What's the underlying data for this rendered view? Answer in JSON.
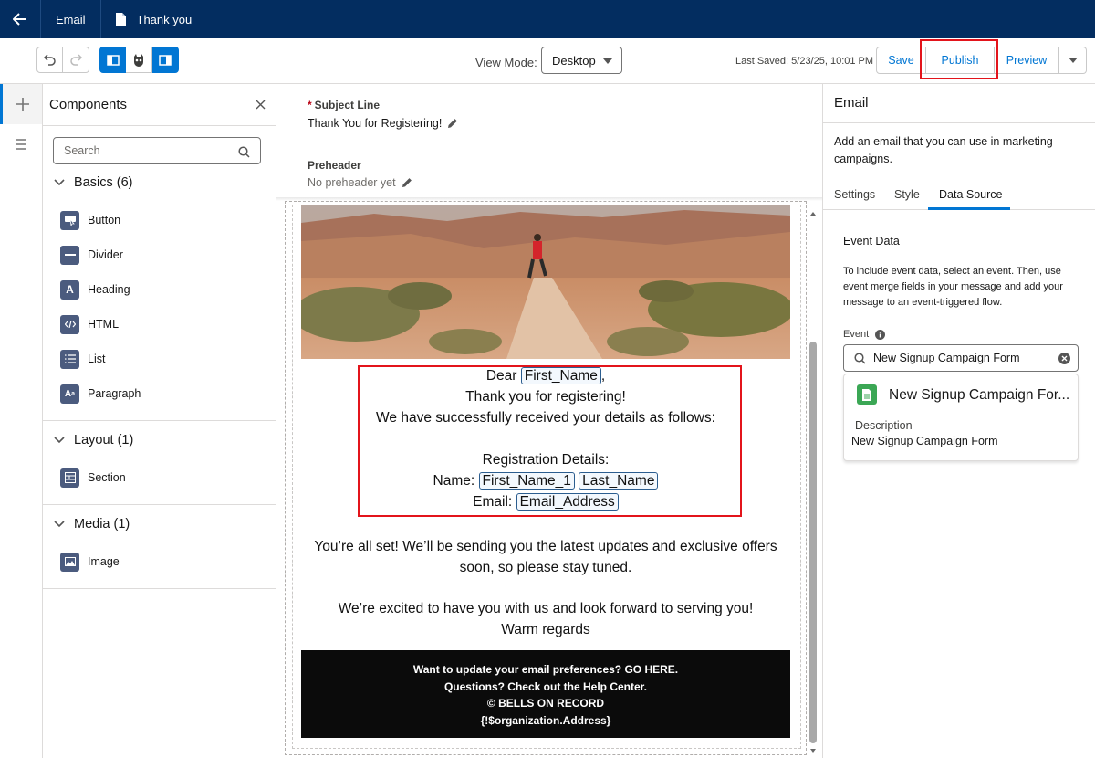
{
  "topbar": {
    "tabs": [
      {
        "label": "Email"
      },
      {
        "label": "Thank you"
      }
    ]
  },
  "toolbar": {
    "view_mode_label": "View Mode:",
    "view_mode_value": "Desktop",
    "last_saved": "Last Saved: 5/23/25, 10:01 PM",
    "save_label": "Save",
    "publish_label": "Publish",
    "preview_label": "Preview"
  },
  "components": {
    "title": "Components",
    "search_placeholder": "Search",
    "sections": [
      {
        "label": "Basics (6)",
        "items": [
          "Button",
          "Divider",
          "Heading",
          "HTML",
          "List",
          "Paragraph"
        ]
      },
      {
        "label": "Layout (1)",
        "items": [
          "Section"
        ]
      },
      {
        "label": "Media (1)",
        "items": [
          "Image"
        ]
      }
    ]
  },
  "canvas": {
    "subject_label": "Subject Line",
    "subject_value": "Thank You for Registering!",
    "preheader_label": "Preheader",
    "preheader_value": "No preheader yet",
    "email": {
      "dear": "Dear",
      "first_name": "First_Name",
      "comma": ",",
      "thanks": "Thank you for registering!",
      "received": "We have successfully received your details as follows:",
      "reg_details": "Registration Details:",
      "name_label": "Name:",
      "first_name_1": "First_Name_1",
      "last_name": "Last_Name",
      "email_label": "Email:",
      "email_address": "Email_Address",
      "all_set_1": "You’re all set! We’ll be sending you the latest updates and exclusive offers",
      "all_set_2": "soon, so please stay tuned.",
      "excited": "We’re excited to have you with us and look forward to serving you!",
      "regards": "Warm regards",
      "footer": [
        "Want to update your email preferences? GO HERE.",
        "Questions? Check out the Help Center.",
        "© BELLS ON RECORD",
        "{!$organization.Address}"
      ]
    }
  },
  "right_panel": {
    "title": "Email",
    "description": "Add an email that you can use in marketing campaigns.",
    "tabs": [
      "Settings",
      "Style",
      "Data Source"
    ],
    "active_tab": "Data Source",
    "event_data_title": "Event Data",
    "event_data_desc": "To include event data, select an event. Then, use event merge fields in your message and add your message to an event-triggered flow.",
    "event_label": "Event",
    "event_value": "New Signup Campaign Form",
    "card_title": "New Signup Campaign For...",
    "card_desc_label": "Description",
    "card_desc_value": "New Signup Campaign Form"
  },
  "colors": {
    "header_bg": "#032d60",
    "accent": "#0176d3",
    "highlight": "#e3141b",
    "form_icon": "#3ba755"
  }
}
